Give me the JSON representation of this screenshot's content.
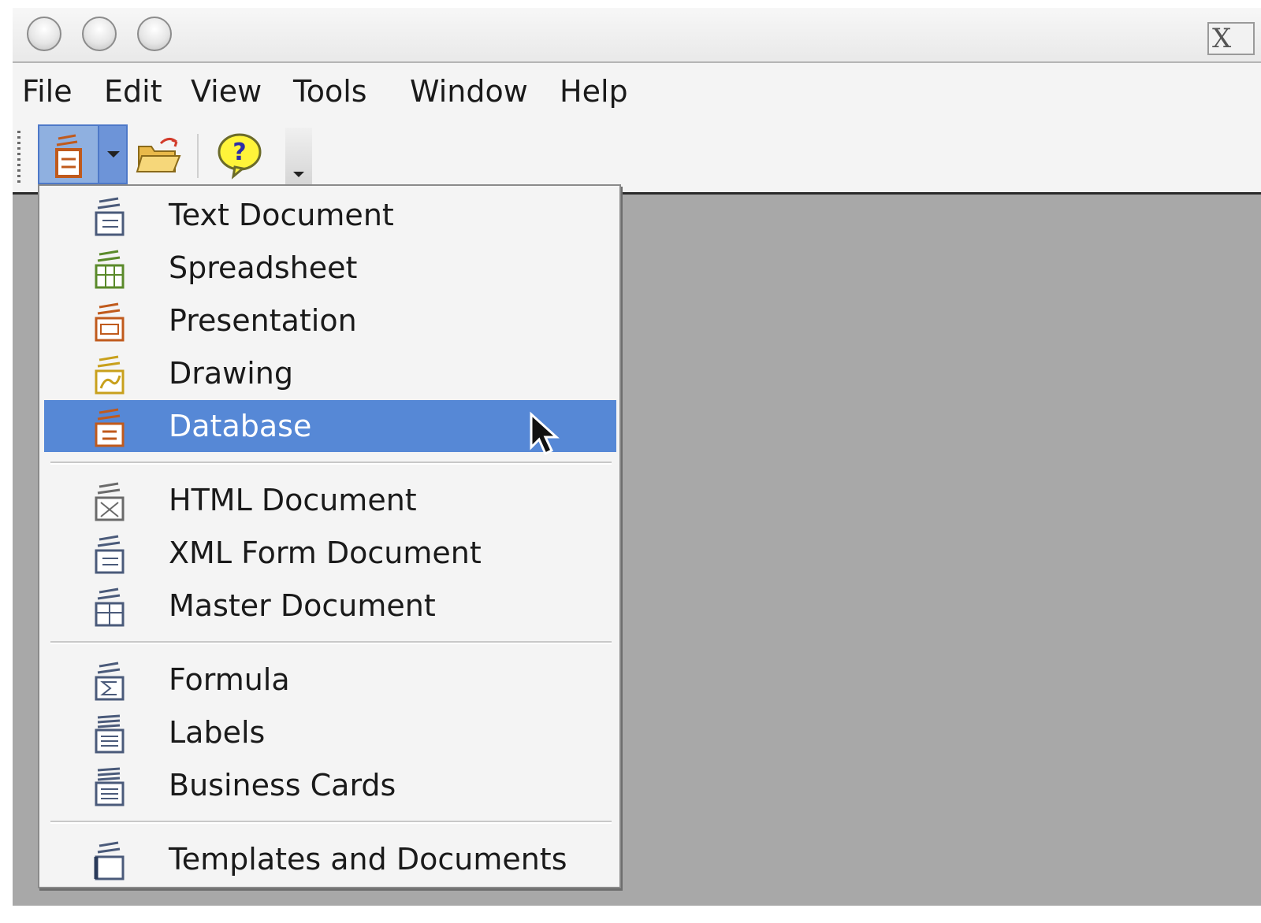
{
  "window": {
    "close_glyph": "X"
  },
  "menubar": {
    "items": [
      {
        "label": "File"
      },
      {
        "label": "Edit"
      },
      {
        "label": "View"
      },
      {
        "label": "Tools"
      },
      {
        "label": "Window"
      },
      {
        "label": "Help"
      }
    ]
  },
  "toolbar": {
    "buttons": [
      {
        "icon": "new-document-icon"
      },
      {
        "icon": "dropdown-arrow-icon"
      },
      {
        "icon": "open-folder-icon"
      },
      {
        "icon": "help-icon"
      },
      {
        "icon": "toolbar-overflow-icon"
      }
    ]
  },
  "new_menu": {
    "items": [
      {
        "label": "Text Document",
        "icon": "text-document-icon"
      },
      {
        "label": "Spreadsheet",
        "icon": "spreadsheet-icon"
      },
      {
        "label": "Presentation",
        "icon": "presentation-icon"
      },
      {
        "label": "Drawing",
        "icon": "drawing-icon"
      },
      {
        "label": "Database",
        "icon": "database-icon",
        "highlighted": true
      },
      {
        "label": "HTML Document",
        "icon": "html-document-icon"
      },
      {
        "label": "XML Form Document",
        "icon": "xml-form-document-icon"
      },
      {
        "label": "Master Document",
        "icon": "master-document-icon"
      },
      {
        "label": "Formula",
        "icon": "formula-icon"
      },
      {
        "label": "Labels",
        "icon": "labels-icon"
      },
      {
        "label": "Business Cards",
        "icon": "business-cards-icon"
      },
      {
        "label": "Templates and Documents",
        "icon": "templates-icon"
      }
    ]
  },
  "colors": {
    "highlight": "#5688d6",
    "workspace": "#a8a8a8",
    "menu_background": "#f4f4f4"
  }
}
